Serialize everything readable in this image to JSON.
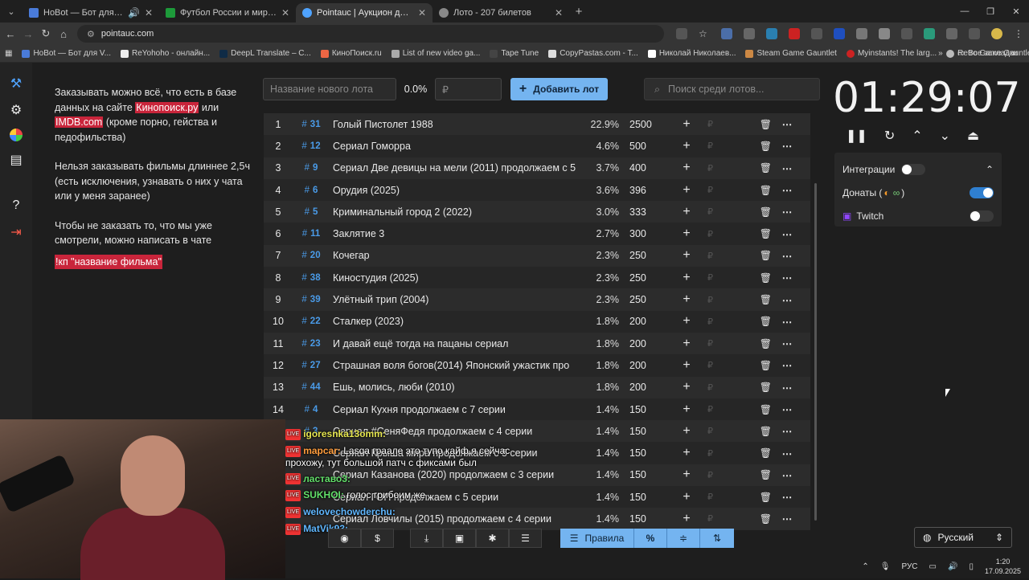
{
  "browser": {
    "tabs": [
      {
        "title": "HoBot — Бот для VK Video",
        "color": "#4a7bd9",
        "active": false
      },
      {
        "title": "Футбол России и мира 2025 -",
        "color": "#1d9a3a",
        "active": false
      },
      {
        "title": "Pointauc | Аукцион для стрим",
        "color": "#4fa3ff",
        "active": true
      },
      {
        "title": "Лото - 207 билетов",
        "color": "#888888",
        "active": false
      }
    ],
    "url": "pointauc.com",
    "bookmarks": [
      "HoBot — Бот для V...",
      "ReYohoho - онлайн...",
      "DeepL Translate – С...",
      "КиноПоиск.ru",
      "List of new video ga...",
      "Tape Tune",
      "CopyPastas.com - T...",
      "Николай Николаев...",
      "Steam Game Gauntlet",
      "Myinstants! The larg...",
      "Retro Game Gauntlet"
    ],
    "all_bookmarks": "Все закладки"
  },
  "rules": {
    "p1_a": "Заказывать можно всё, что есть в базе данных на сайте ",
    "p1_link1": "Кинопоиск.ру",
    "p1_b": " или ",
    "p1_link2": "IMDB.com",
    "p1_c": " (кроме порно, гейства и педофильства)",
    "p2": "Нельзя заказывать фильмы длиннее 2,5ч (есть исключения, узнавать о них у чата или у меня заранее)",
    "p3": "Чтобы не заказать то, что мы уже смотрели, можно написать в чате",
    "p3_cmd": "!кп \"название фильма\""
  },
  "controls": {
    "new_lot_placeholder": "Название нового лота",
    "pct": "0.0%",
    "amount_placeholder": "₽",
    "add_label": "Добавить лот",
    "search_placeholder": "Поиск среди лотов..."
  },
  "lots": [
    {
      "n": "1",
      "id": "31",
      "name": "Голый Пистолет 1988",
      "pct": "22.9%",
      "sum": "2500"
    },
    {
      "n": "2",
      "id": "12",
      "name": "Сериал Гоморра",
      "pct": "4.6%",
      "sum": "500"
    },
    {
      "n": "3",
      "id": "9",
      "name": "Сериал Две девицы на мели (2011) продолжаем с 5",
      "pct": "3.7%",
      "sum": "400"
    },
    {
      "n": "4",
      "id": "6",
      "name": "Орудия (2025)",
      "pct": "3.6%",
      "sum": "396"
    },
    {
      "n": "5",
      "id": "5",
      "name": "Криминальный город 2 (2022)",
      "pct": "3.0%",
      "sum": "333"
    },
    {
      "n": "6",
      "id": "11",
      "name": "Заклятие 3",
      "pct": "2.7%",
      "sum": "300"
    },
    {
      "n": "7",
      "id": "20",
      "name": "Кочегар",
      "pct": "2.3%",
      "sum": "250"
    },
    {
      "n": "8",
      "id": "38",
      "name": "Киностудия (2025)",
      "pct": "2.3%",
      "sum": "250"
    },
    {
      "n": "9",
      "id": "39",
      "name": "Улётный трип (2004)",
      "pct": "2.3%",
      "sum": "250"
    },
    {
      "n": "10",
      "id": "22",
      "name": "Сталкер (2023)",
      "pct": "1.8%",
      "sum": "200"
    },
    {
      "n": "11",
      "id": "23",
      "name": "И давай ещё тогда на пацаны сериал",
      "pct": "1.8%",
      "sum": "200"
    },
    {
      "n": "12",
      "id": "27",
      "name": "Страшная воля богов(2014) Японский ужастик про",
      "pct": "1.8%",
      "sum": "200"
    },
    {
      "n": "13",
      "id": "44",
      "name": "Ешь, молись, люби (2010)",
      "pct": "1.8%",
      "sum": "200"
    },
    {
      "n": "14",
      "id": "4",
      "name": "Сериал Кухня продолжаем с 7 серии",
      "pct": "1.4%",
      "sum": "150"
    },
    {
      "n": "15",
      "id": "3",
      "name": "Сериал #СеняФедя продолжаем с 4 серии",
      "pct": "1.4%",
      "sum": "150"
    },
    {
      "n": "16",
      "id": "",
      "name": "Сериал Крыша мира продолжаем с 5 серии",
      "pct": "1.4%",
      "sum": "150"
    },
    {
      "n": "17",
      "id": "",
      "name": "Сериал Казанова (2020) продолжаем с 3 серии",
      "pct": "1.4%",
      "sum": "150"
    },
    {
      "n": "18",
      "id": "",
      "name": "Сериал ГОП продолжаем с 5 серии",
      "pct": "1.4%",
      "sum": "150"
    },
    {
      "n": "19",
      "id": "",
      "name": "Сериал Ловчилы (2015) продолжаем с 4 серии",
      "pct": "1.4%",
      "sum": "150"
    }
  ],
  "timer": {
    "value": "01:29:07"
  },
  "integrations": {
    "title": "Интеграции",
    "donations": "Донаты (",
    "donations_close": ")",
    "twitch": "Twitch"
  },
  "chat": [
    {
      "user": "igoresnka13omm:",
      "text": "",
      "cls": "y"
    },
    {
      "user": "mapcar:",
      "text": "Lasqa граале это тупо кайф я сейчас прохожу, тут большой патч с фиксами был",
      "cls": "o"
    },
    {
      "user": "ластаво3:",
      "text": "",
      "cls": "g"
    },
    {
      "user": "SUKHOI:",
      "text": "голос грибоим же",
      "cls": "g"
    },
    {
      "user": "welovechowderchu:",
      "text": "",
      "cls": ""
    },
    {
      "user": "MatVik93:",
      "text": "",
      "cls": ""
    }
  ],
  "bottom": {
    "rules_label": "Правила",
    "pct_symbol": "%",
    "language": "Русский"
  },
  "taskbar": {
    "lang": "РУС",
    "time": "1:20",
    "date": "17.09.2025"
  }
}
